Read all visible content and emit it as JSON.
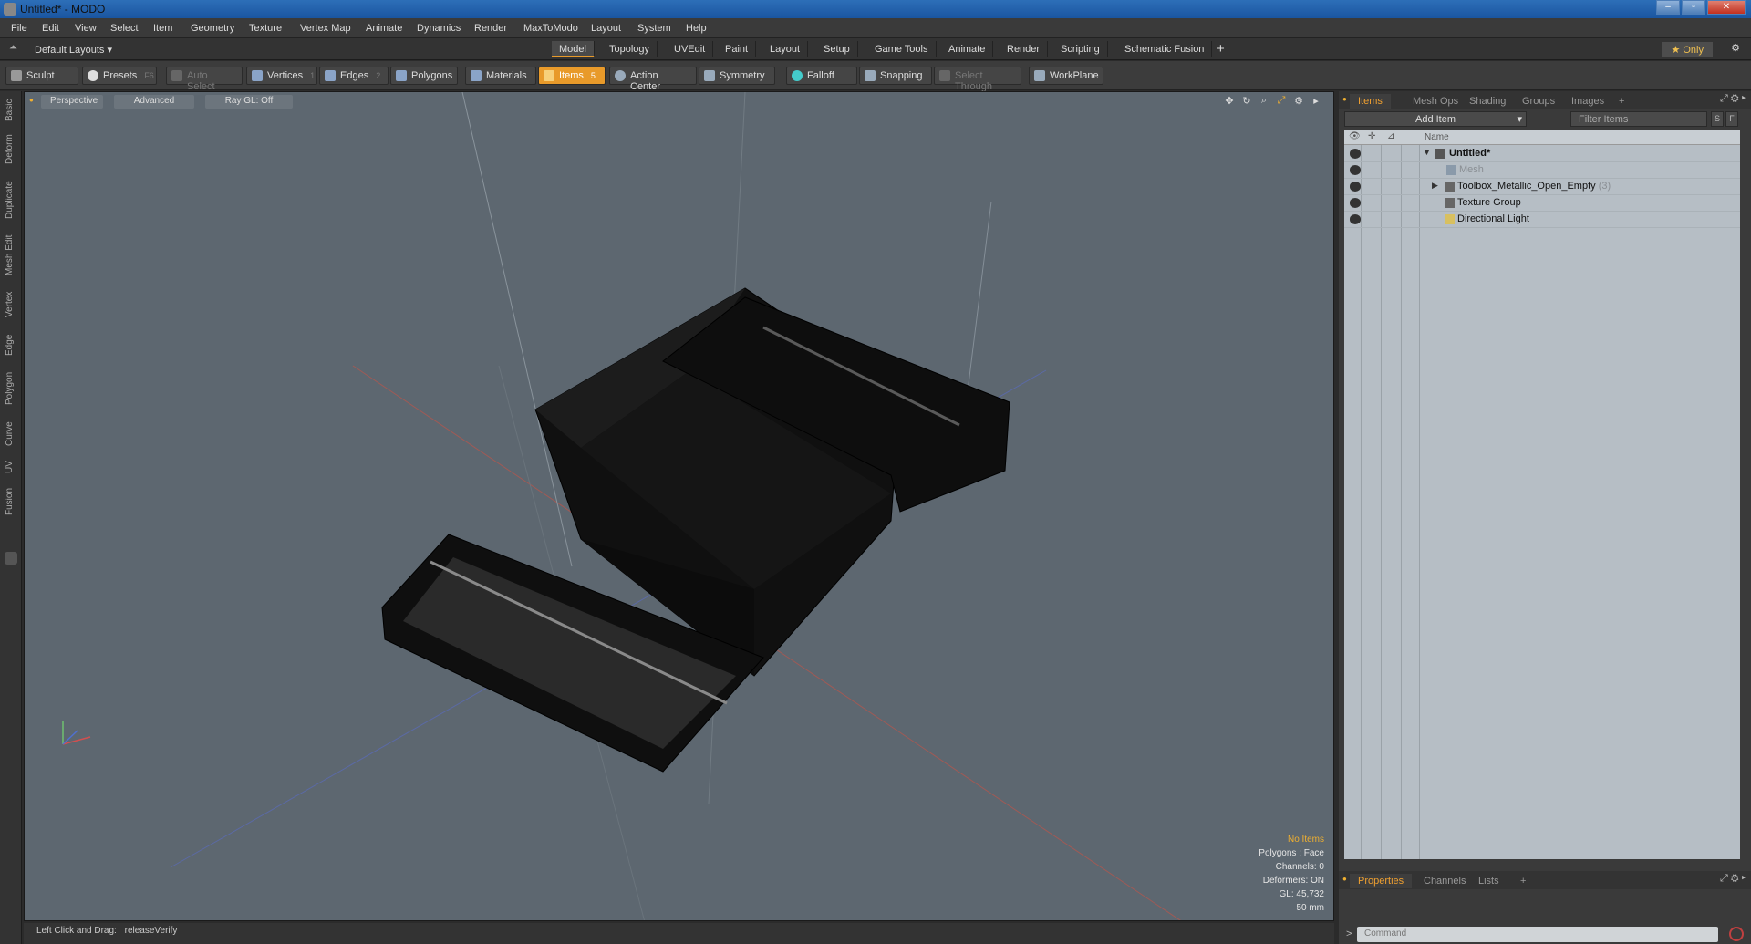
{
  "window": {
    "title": "Untitled* - MODO"
  },
  "menu": [
    "File",
    "Edit",
    "View",
    "Select",
    "Item",
    "Geometry",
    "Texture",
    "Vertex Map",
    "Animate",
    "Dynamics",
    "Render",
    "MaxToModo",
    "Layout",
    "System",
    "Help"
  ],
  "layout": {
    "selector": "Default Layouts",
    "tabs": [
      "Model",
      "Topology",
      "UVEdit",
      "Paint",
      "Layout",
      "Setup",
      "Game Tools",
      "Animate",
      "Render",
      "Scripting",
      "Schematic Fusion"
    ],
    "active_tab": "Model",
    "add_tab": "+",
    "only_label": "Only"
  },
  "toolbar": {
    "sculpt": "Sculpt",
    "presets": "Presets",
    "presets_key": "F6",
    "auto_select": "Auto Select",
    "vertices": "Vertices",
    "vertices_key": "1",
    "edges": "Edges",
    "edges_key": "2",
    "polygons": "Polygons",
    "materials": "Materials",
    "items": "Items",
    "items_key": "5",
    "action_center": "Action Center",
    "symmetry": "Symmetry",
    "falloff": "Falloff",
    "snapping": "Snapping",
    "select_through": "Select Through",
    "workplane": "WorkPlane"
  },
  "left_tabs": [
    "Basic",
    "Deform",
    "Duplicate",
    "Mesh Edit",
    "Vertex",
    "Edge",
    "Polygon",
    "Curve",
    "UV",
    "Fusion"
  ],
  "viewport": {
    "perspective": "Perspective",
    "advanced": "Advanced",
    "raygl": "Ray GL: Off",
    "info": {
      "selection": "No Items",
      "polygons": "Polygons : Face",
      "channels": "Channels: 0",
      "deformers": "Deformers: ON",
      "gl": "GL: 45,732",
      "units": "50 mm"
    }
  },
  "status": {
    "hint": "Left Click and Drag:",
    "action": "releaseVerify"
  },
  "items_panel": {
    "tabs": [
      "Items",
      "Mesh Ops",
      "Shading",
      "Groups",
      "Images"
    ],
    "active_tab": "Items",
    "add_item": "Add Item",
    "filter_placeholder": "Filter Items",
    "btn_s": "S",
    "btn_f": "F",
    "column_name": "Name",
    "rows": [
      {
        "label": "Untitled*",
        "type": "scene"
      },
      {
        "label": "Mesh",
        "type": "mesh"
      },
      {
        "label": "Toolbox_Metallic_Open_Empty",
        "count": "(3)",
        "type": "group"
      },
      {
        "label": "Texture Group",
        "type": "group"
      },
      {
        "label": "Directional Light",
        "type": "light"
      }
    ]
  },
  "properties_panel": {
    "tabs": [
      "Properties",
      "Channels",
      "Lists"
    ],
    "active_tab": "Properties",
    "command_placeholder": "Command",
    "prompt": ">"
  }
}
